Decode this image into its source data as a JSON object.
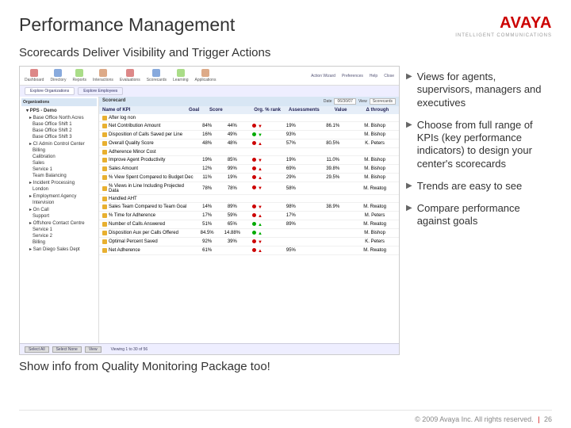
{
  "header": {
    "title": "Performance Management",
    "logo_text": "AVAYA",
    "logo_sub": "INTELLIGENT COMMUNICATIONS"
  },
  "subtitle": "Scorecards Deliver Visibility and Trigger Actions",
  "bullets": [
    "Views for agents, supervisors, managers and executives",
    "Choose from full range of KPIs (key performance indicators) to design your center's scorecards",
    "Trends are easy to see",
    "Compare performance against goals"
  ],
  "callout": "Show info from Quality Monitoring Package too!",
  "footer": {
    "copyright": "© 2009 Avaya Inc. All rights reserved.",
    "page": "26"
  },
  "screenshot": {
    "toolbar": [
      "Dashboard",
      "Directory",
      "Reports",
      "Interactions",
      "Evaluations",
      "Scorecards",
      "Learning",
      "Applications"
    ],
    "toolbar_right": [
      "Action Wizard",
      "Preferences",
      "Help",
      "Close"
    ],
    "tabs": [
      "Explore Organizations",
      "Explore Employees"
    ],
    "side_header": "Organizations",
    "tree_root": "PPS - Demo",
    "tree": [
      {
        "t": "Base Office North Acres",
        "l": 0
      },
      {
        "t": "Base Office Shift 1",
        "l": 1
      },
      {
        "t": "Base Office Shift 2",
        "l": 1
      },
      {
        "t": "Base Office Shift 3",
        "l": 1
      },
      {
        "t": "CI Admin Control Center",
        "l": 0
      },
      {
        "t": "Billing",
        "l": 1
      },
      {
        "t": "Calibration",
        "l": 1
      },
      {
        "t": "Sales",
        "l": 1
      },
      {
        "t": "Service 1",
        "l": 1
      },
      {
        "t": "Team Balancing",
        "l": 1
      },
      {
        "t": "Incident Processing",
        "l": 0
      },
      {
        "t": "London",
        "l": 1
      },
      {
        "t": "Employment Agency",
        "l": 0
      },
      {
        "t": "Intervision",
        "l": 1
      },
      {
        "t": "On Call",
        "l": 0
      },
      {
        "t": "Support",
        "l": 1
      },
      {
        "t": "Offshore Contact Centre",
        "l": 0
      },
      {
        "t": "Service 1",
        "l": 1
      },
      {
        "t": "Service 2",
        "l": 1
      },
      {
        "t": "Billing",
        "l": 1
      },
      {
        "t": "San Diego Sales Dept",
        "l": 0
      }
    ],
    "main_header": "Scorecard",
    "ctrl_date_label": "Date",
    "ctrl_date_value": "06/30/07",
    "ctrl_view_label": "View",
    "ctrl_view_value": "Scorecards",
    "columns": [
      "Name of KPI",
      "Goal",
      "Score",
      "",
      "Org. % rank",
      "Assessments",
      "Value",
      "Δ through"
    ],
    "rows": [
      {
        "n": "After log non",
        "g": "",
        "s": "",
        "t": "",
        "r": "",
        "a": "",
        "v": ""
      },
      {
        "n": "Net Contribution Amount",
        "g": "84%",
        "s": "44%",
        "t": "down-r",
        "r": "19%",
        "a": "86.1%",
        "v": "M. Bishop"
      },
      {
        "n": "Disposition of Calls Saved per Line",
        "g": "16%",
        "s": "49%",
        "t": "down-g",
        "r": "93%",
        "a": "",
        "v": "M. Bishop"
      },
      {
        "n": "Overall Quality Score",
        "g": "48%",
        "s": "48%",
        "t": "up-r",
        "r": "57%",
        "a": "80.5%",
        "v": "K. Peters"
      },
      {
        "n": "Adherence Minor Cost",
        "g": "",
        "s": "",
        "t": "",
        "r": "",
        "a": "",
        "v": ""
      },
      {
        "n": "Improve Agent Productivity",
        "g": "19%",
        "s": "85%",
        "t": "down-r",
        "r": "19%",
        "a": "11.0%",
        "v": "M. Bishop"
      },
      {
        "n": "Sales Amount",
        "g": "12%",
        "s": "99%",
        "t": "up-r",
        "r": "69%",
        "a": "39.8%",
        "v": "M. Bishop"
      },
      {
        "n": "% View Spent Compared to Budget Dec",
        "g": "11%",
        "s": "19%",
        "t": "up-r",
        "r": "29%",
        "a": "29.5%",
        "v": "M. Bishop"
      },
      {
        "n": "% Views in Line Including Projected Data",
        "g": "78%",
        "s": "78%",
        "t": "down-r",
        "r": "58%",
        "a": "",
        "v": "M. Rwatog"
      },
      {
        "n": "Handled AHT",
        "g": "",
        "s": "",
        "t": "",
        "r": "",
        "a": "",
        "v": ""
      },
      {
        "n": "Sales Team Compared to Team Goal",
        "g": "14%",
        "s": "89%",
        "t": "down-r",
        "r": "98%",
        "a": "38.9%",
        "v": "M. Rwatog"
      },
      {
        "n": "% Time for Adherence",
        "g": "17%",
        "s": "59%",
        "t": "up-r",
        "r": "17%",
        "a": "",
        "v": "M. Peters"
      },
      {
        "n": "Number of Calls Answered",
        "g": "51%",
        "s": "65%",
        "t": "up-g",
        "r": "89%",
        "a": "",
        "v": "M. Rwatog"
      },
      {
        "n": "Disposition Aux per Calls Offered",
        "g": "84.5%",
        "s": "14.88%",
        "t": "up-g",
        "r": "",
        "a": "",
        "v": "M. Bishop"
      },
      {
        "n": "Optimal Percent Saved",
        "g": "92%",
        "s": "39%",
        "t": "down-r",
        "r": "",
        "a": "",
        "v": "K. Peters"
      },
      {
        "n": "Net Adherence",
        "g": "61%",
        "s": "",
        "t": "up-r",
        "r": "95%",
        "a": "",
        "v": "M. Rwatog"
      }
    ],
    "footer_buttons": [
      "Select All",
      "Select None",
      "View"
    ],
    "footer_text": "Viewing 1 to 30 of 56"
  }
}
